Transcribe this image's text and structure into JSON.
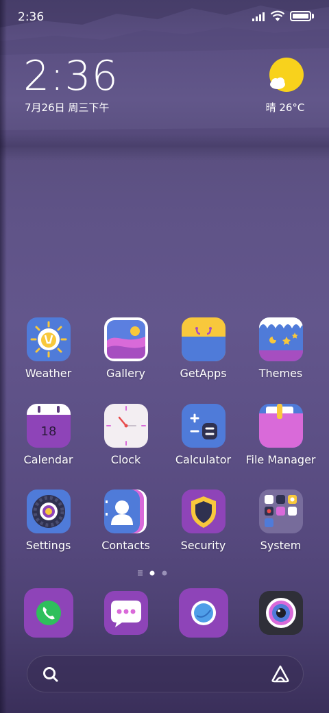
{
  "status_bar": {
    "time": "2:36"
  },
  "clock_widget": {
    "time": "2:36",
    "date": "7月26日 周三下午"
  },
  "weather_widget": {
    "condition_temp": "晴 26°C",
    "icon": "sunny-cloud-icon"
  },
  "apps": [
    {
      "label": "Weather",
      "icon": "weather-icon"
    },
    {
      "label": "Gallery",
      "icon": "gallery-icon"
    },
    {
      "label": "GetApps",
      "icon": "getapps-icon"
    },
    {
      "label": "Themes",
      "icon": "themes-icon"
    },
    {
      "label": "Calendar",
      "icon": "calendar-icon",
      "day": "18"
    },
    {
      "label": "Clock",
      "icon": "clock-icon"
    },
    {
      "label": "Calculator",
      "icon": "calculator-icon"
    },
    {
      "label": "File Manager",
      "icon": "file-manager-icon"
    },
    {
      "label": "Settings",
      "icon": "settings-icon"
    },
    {
      "label": "Contacts",
      "icon": "contacts-icon"
    },
    {
      "label": "Security",
      "icon": "security-icon"
    },
    {
      "label": "System",
      "icon": "system-folder-icon"
    }
  ],
  "page_indicator": {
    "pages": 2,
    "current": 1
  },
  "dock": [
    {
      "icon": "phone-icon"
    },
    {
      "icon": "messages-icon"
    },
    {
      "icon": "browser-icon"
    },
    {
      "icon": "camera-icon"
    }
  ],
  "search_bar": {
    "search_icon": "search-icon",
    "assistant_icon": "assistant-icon"
  },
  "colors": {
    "purple": "#8e44b8",
    "blue": "#4f7bd9",
    "pink": "#d96ad9",
    "yellow": "#f8c83c"
  }
}
